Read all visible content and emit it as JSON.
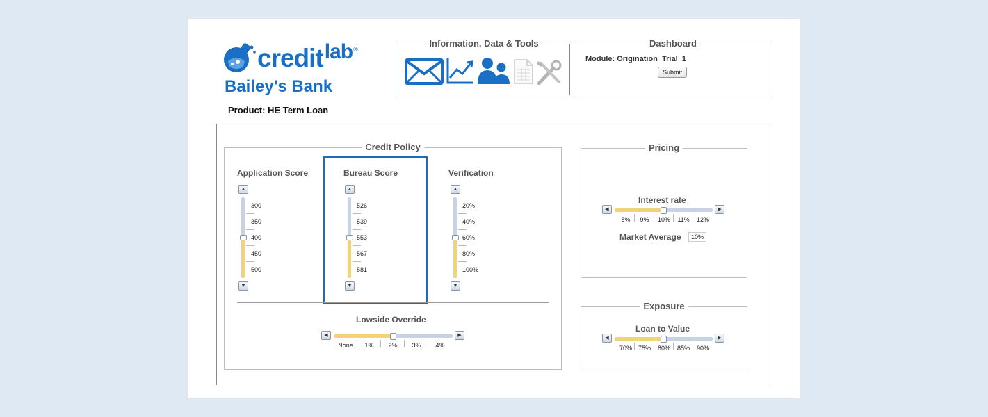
{
  "header": {
    "brand_word": "credit",
    "brand_lab": "lab",
    "brand_reg": "®",
    "bank_name": "Bailey's Bank",
    "product": "Product: HE Term Loan"
  },
  "tools": {
    "title": "Information, Data & Tools",
    "icons": [
      "envelope-icon",
      "trend-chart-icon",
      "users-icon",
      "spreadsheet-icon",
      "tools-icon"
    ]
  },
  "dashboard": {
    "title": "Dashboard",
    "module_label": "Module: Origination",
    "trial_label": "Trial",
    "trial_value": "1",
    "submit_label": "Submit"
  },
  "credit_policy": {
    "title": "Credit Policy",
    "application_score": {
      "title": "Application Score",
      "ticks": [
        "300",
        "350",
        "400",
        "450",
        "500"
      ],
      "selected_index": 2
    },
    "bureau_score": {
      "title": "Bureau Score",
      "ticks": [
        "526",
        "539",
        "553",
        "567",
        "581"
      ],
      "selected_index": 2
    },
    "verification": {
      "title": "Verification",
      "ticks": [
        "20%",
        "40%",
        "60%",
        "80%",
        "100%"
      ],
      "selected_index": 2
    },
    "lowside_override": {
      "title": "Lowside Override",
      "ticks": [
        "None",
        "1%",
        "2%",
        "3%",
        "4%"
      ],
      "selected_index": 2
    }
  },
  "pricing": {
    "title": "Pricing",
    "interest_rate": {
      "title": "Interest rate",
      "ticks": [
        "8%",
        "9%",
        "10%",
        "11%",
        "12%"
      ],
      "selected_index": 2
    },
    "market_average_label": "Market Average",
    "market_average_value": "10%"
  },
  "exposure": {
    "title": "Exposure",
    "loan_to_value": {
      "title": "Loan to Value",
      "ticks": [
        "70%",
        "75%",
        "80%",
        "85%",
        "90%"
      ],
      "selected_index": 2
    }
  },
  "colors": {
    "brand_blue": "#1a6fc4",
    "track_gold": "#f2d27a",
    "track_blue": "#c7d3e3",
    "selection_border": "#1f6bb5"
  }
}
